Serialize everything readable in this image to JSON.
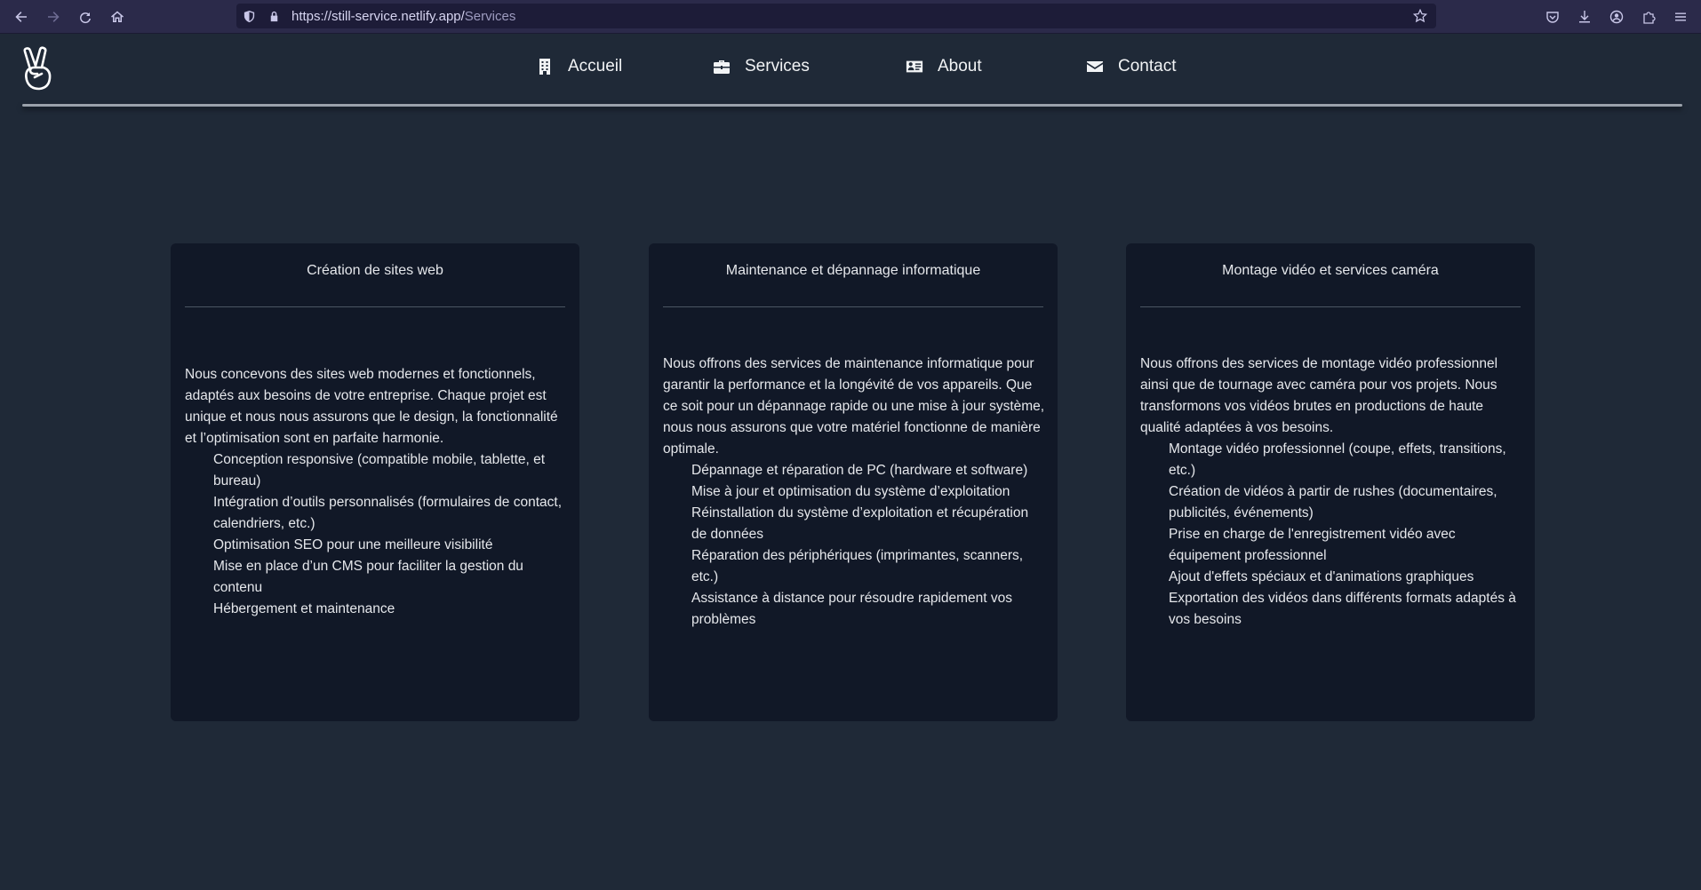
{
  "browser": {
    "url_host": "https://still-service.netlify.app/",
    "url_path": "Services"
  },
  "nav": {
    "items": [
      {
        "label": "Accueil",
        "icon": "building-icon"
      },
      {
        "label": "Services",
        "icon": "toolbox-icon"
      },
      {
        "label": "About",
        "icon": "id-card-icon"
      },
      {
        "label": "Contact",
        "icon": "envelope-icon"
      }
    ]
  },
  "cards": [
    {
      "title": "Création de sites web",
      "intro": "Nous concevons des sites web modernes et fonctionnels, adaptés aux besoins de votre entreprise. Chaque projet est unique et nous nous assurons que le design, la fonctionnalité et l’optimisation sont en parfaite harmonie.",
      "items": [
        "Conception responsive (compatible mobile, tablette, et bureau)",
        "Intégration d’outils personnalisés (formulaires de contact, calendriers, etc.)",
        "Optimisation SEO pour une meilleure visibilité",
        "Mise en place d’un CMS pour faciliter la gestion du contenu",
        "Hébergement et maintenance"
      ]
    },
    {
      "title": "Maintenance et dépannage informatique",
      "intro": "Nous offrons des services de maintenance informatique pour garantir la performance et la longévité de vos appareils. Que ce soit pour un dépannage rapide ou une mise à jour système, nous nous assurons que votre matériel fonctionne de manière optimale.",
      "items": [
        "Dépannage et réparation de PC (hardware et software)",
        "Mise à jour et optimisation du système d’exploitation",
        "Réinstallation du système d’exploitation et récupération de données",
        "Réparation des périphériques (imprimantes, scanners, etc.)",
        "Assistance à distance pour résoudre rapidement vos problèmes"
      ]
    },
    {
      "title": "Montage vidéo et services caméra",
      "intro": "Nous offrons des services de montage vidéo professionnel ainsi que de tournage avec caméra pour vos projets. Nous transformons vos vidéos brutes en productions de haute qualité adaptées à vos besoins.",
      "items": [
        "Montage vidéo professionnel (coupe, effets, transitions, etc.)",
        "Création de vidéos à partir de rushes (documentaires, publicités, événements)",
        "Prise en charge de l'enregistrement vidéo avec équipement professionnel",
        "Ajout d'effets spéciaux et d'animations graphiques",
        "Exportation des vidéos dans différents formats adaptés à vos besoins"
      ]
    }
  ]
}
